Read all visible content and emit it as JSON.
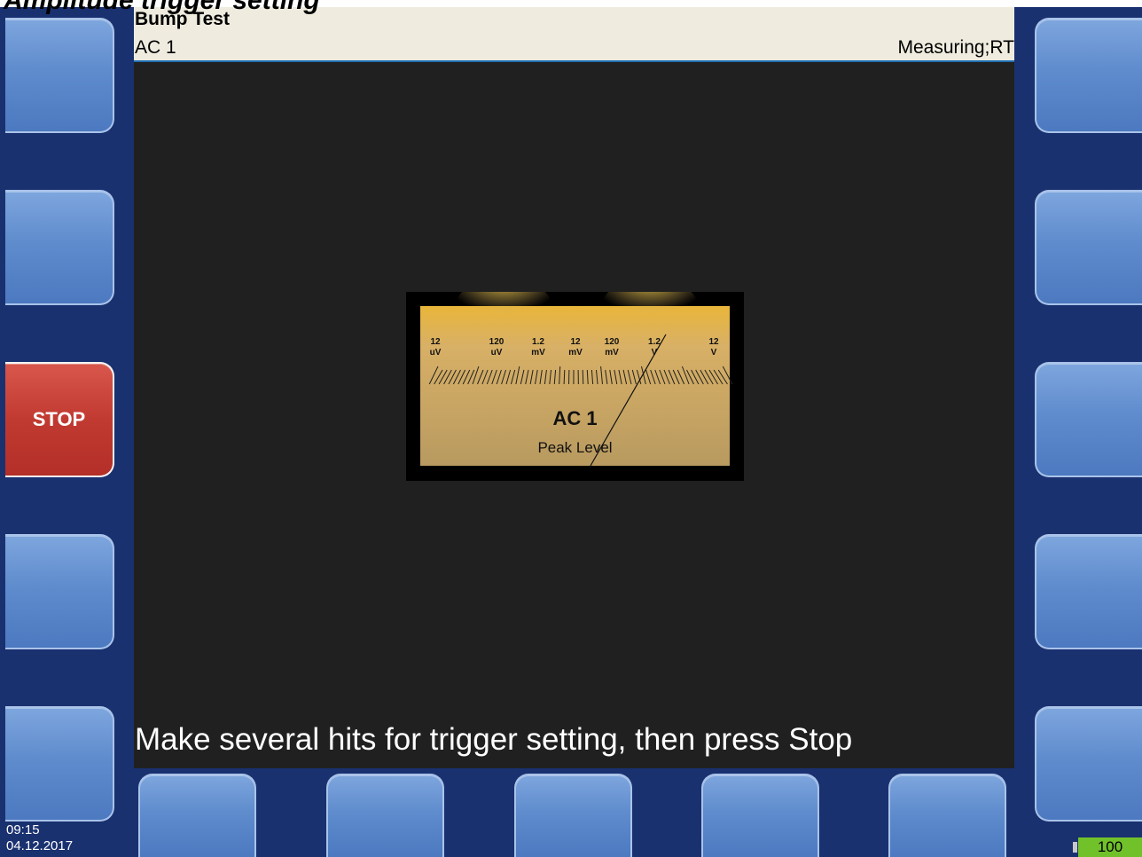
{
  "document_title": "Amplitude trigger setting",
  "header": {
    "title": "Bump Test",
    "channel": "AC 1",
    "status": "Measuring;RT"
  },
  "soft_keys": {
    "left": [
      "",
      "",
      "STOP",
      "",
      ""
    ],
    "right": [
      "",
      "",
      "",
      "",
      ""
    ],
    "bottom": [
      "",
      "",
      "",
      "",
      ""
    ]
  },
  "meter": {
    "scale_labels": [
      {
        "value": "12",
        "unit": "uV"
      },
      {
        "value": "120",
        "unit": "uV"
      },
      {
        "value": "1.2",
        "unit": "mV"
      },
      {
        "value": "12",
        "unit": "mV"
      },
      {
        "value": "120",
        "unit": "mV"
      },
      {
        "value": "1.2",
        "unit": "V"
      },
      {
        "value": "12",
        "unit": "V"
      }
    ],
    "channel": "AC 1",
    "quantity": "Peak Level",
    "needle_value": "1.2 V"
  },
  "instruction": "Make several hits for trigger setting, then press Stop",
  "clock": {
    "time": "09:15",
    "date": "04.12.2017"
  },
  "battery": {
    "level": "100",
    "color": "#71c12a"
  },
  "colors": {
    "frame": "#1a3170",
    "button": "#5f8ccd",
    "stop_button": "#c13a31",
    "screen": "#202020",
    "header": "#efecdf",
    "meter_face": "#c6a667"
  }
}
